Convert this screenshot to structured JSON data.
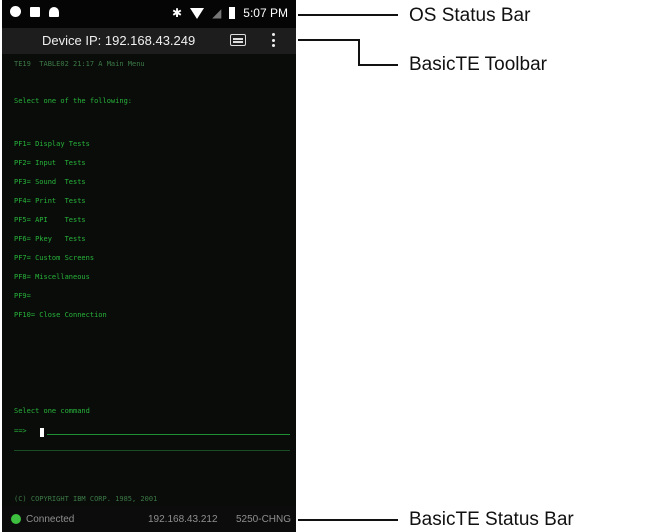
{
  "status_bar": {
    "time": "5:07 PM"
  },
  "toolbar": {
    "title": "Device IP: 192.168.43.249"
  },
  "terminal": {
    "header": "TE19  TABLE02 21:17 A Main Menu",
    "prompt": "Select one of the following:",
    "menu": [
      "PF1= Display Tests",
      "PF2= Input  Tests",
      "PF3= Sound  Tests",
      "PF4= Print  Tests",
      "PF5= API    Tests",
      "PF6= Pkey   Tests",
      "PF7= Custom Screens",
      "PF8= Miscellaneous",
      "PF9=",
      "PF10= Close Connection"
    ],
    "command_prompt": "Select one command",
    "cursor_prefix": "==>",
    "copyright": "(C) COPYRIGHT IBM CORP. 1985, 2001"
  },
  "bottom_status": {
    "connection": "Connected",
    "ip": "192.168.43.212",
    "model": "5250-CHNG"
  },
  "callouts": {
    "os_status_bar": "OS Status Bar",
    "toolbar": "BasicTE Toolbar",
    "status_bar": "BasicTE Status Bar"
  }
}
